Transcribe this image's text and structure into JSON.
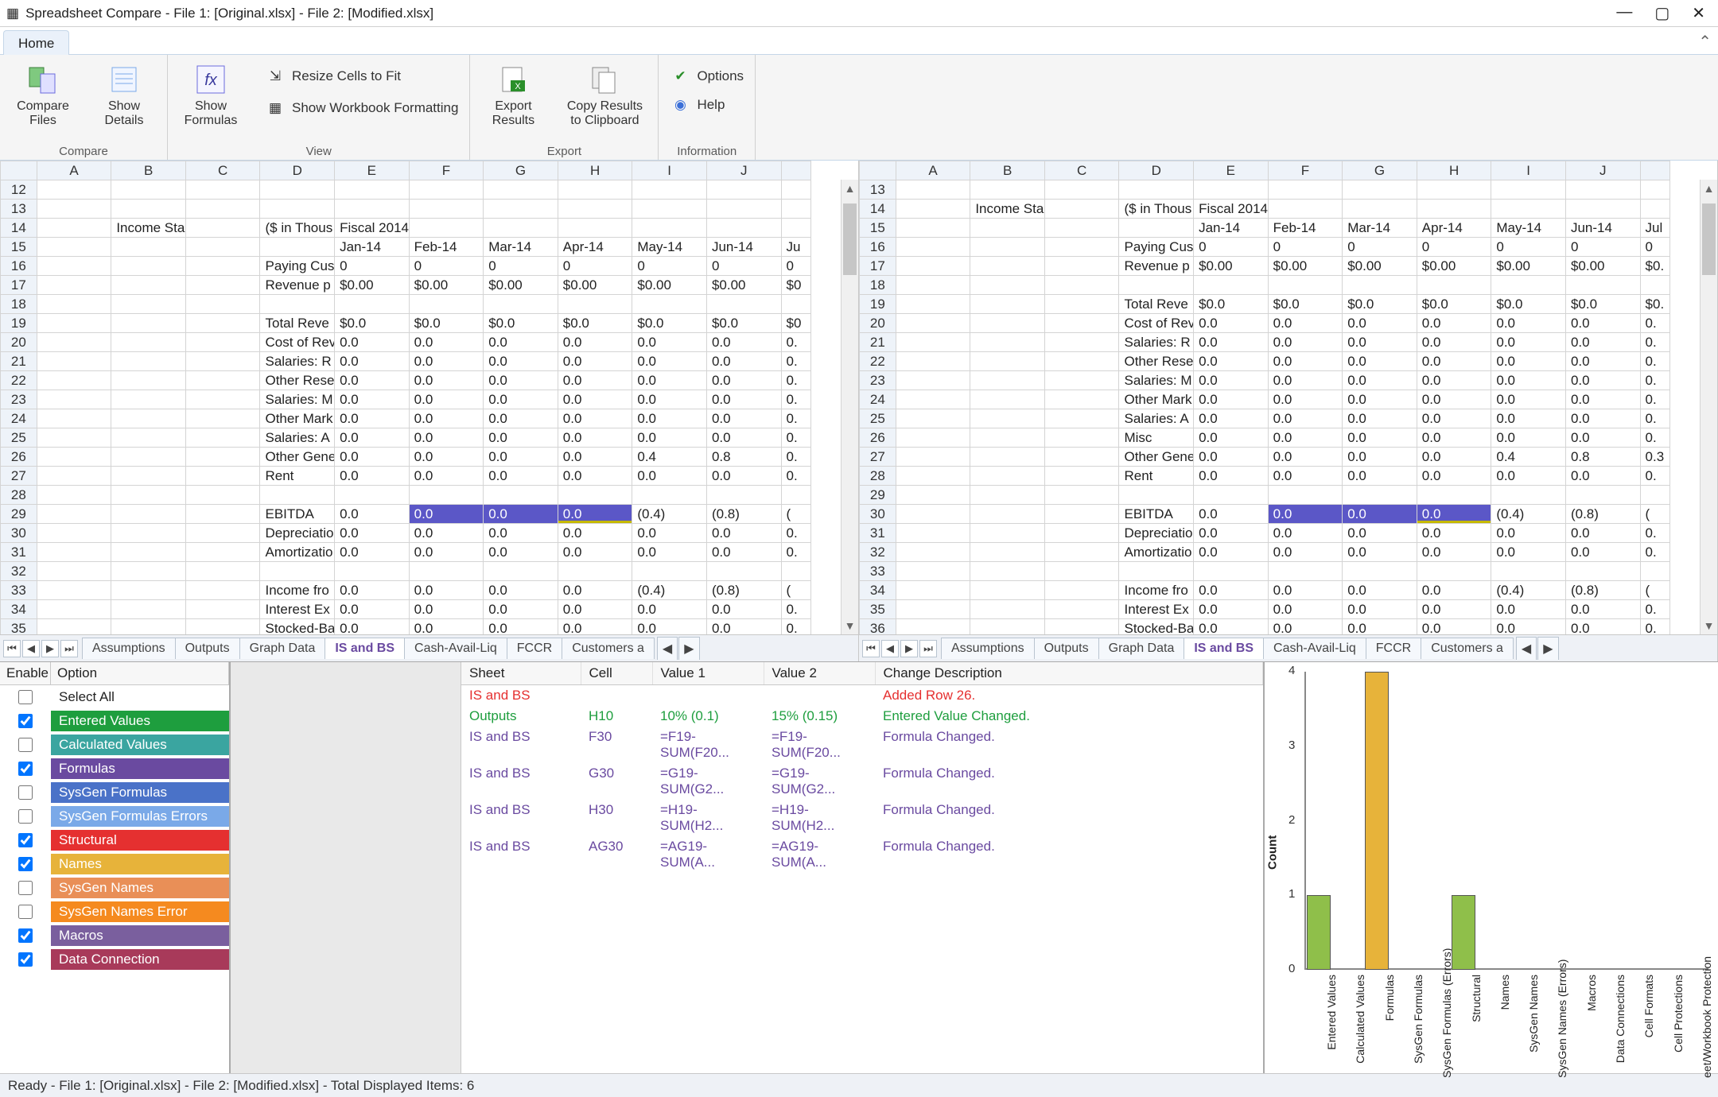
{
  "window": {
    "title": "Spreadsheet Compare - File 1: [Original.xlsx] - File 2: [Modified.xlsx]"
  },
  "ribbon": {
    "tab": "Home",
    "groups": {
      "compare": "Compare",
      "view": "View",
      "export": "Export",
      "information": "Information"
    },
    "buttons": {
      "compare_files": "Compare Files",
      "show_details": "Show Details",
      "show_formulas": "Show Formulas",
      "resize_cells": "Resize Cells to Fit",
      "show_wb_fmt": "Show Workbook Formatting",
      "export_results": "Export Results",
      "copy_clipboard": "Copy Results to Clipboard",
      "options": "Options",
      "help": "Help"
    }
  },
  "sheet_tabs": [
    "Assumptions",
    "Outputs",
    "Graph Data",
    "IS and BS",
    "Cash-Avail-Liq",
    "FCCR",
    "Customers a"
  ],
  "sheet_selected": "IS and BS",
  "columns": [
    "A",
    "B",
    "C",
    "D",
    "E",
    "F",
    "G",
    "H",
    "I",
    "J"
  ],
  "grid_left": {
    "start_row": 12,
    "rows": [
      {
        "r": 12
      },
      {
        "r": 13
      },
      {
        "r": 14,
        "B": "Income Sta",
        "D": "($ in Thous",
        "E": "Fiscal 2014"
      },
      {
        "r": 15,
        "E": "Jan-14",
        "F": "Feb-14",
        "G": "Mar-14",
        "H": "Apr-14",
        "I": "May-14",
        "J": "Jun-14",
        "K": "Ju"
      },
      {
        "r": 16,
        "D": "Paying Cus",
        "E": "0",
        "F": "0",
        "G": "0",
        "H": "0",
        "I": "0",
        "J": "0",
        "K": "0"
      },
      {
        "r": 17,
        "D": "Revenue p",
        "E": "$0.00",
        "F": "$0.00",
        "G": "$0.00",
        "H": "$0.00",
        "I": "$0.00",
        "J": "$0.00",
        "K": "$0"
      },
      {
        "r": 18
      },
      {
        "r": 19,
        "D": "Total Reve",
        "E": "$0.0",
        "F": "$0.0",
        "G": "$0.0",
        "H": "$0.0",
        "I": "$0.0",
        "J": "$0.0",
        "K": "$0"
      },
      {
        "r": 20,
        "D": "Cost of Rev",
        "E": "0.0",
        "F": "0.0",
        "G": "0.0",
        "H": "0.0",
        "I": "0.0",
        "J": "0.0",
        "K": "0."
      },
      {
        "r": 21,
        "D": "Salaries: R",
        "E": "0.0",
        "F": "0.0",
        "G": "0.0",
        "H": "0.0",
        "I": "0.0",
        "J": "0.0",
        "K": "0."
      },
      {
        "r": 22,
        "D": "Other Rese",
        "E": "0.0",
        "F": "0.0",
        "G": "0.0",
        "H": "0.0",
        "I": "0.0",
        "J": "0.0",
        "K": "0."
      },
      {
        "r": 23,
        "D": "Salaries: M",
        "E": "0.0",
        "F": "0.0",
        "G": "0.0",
        "H": "0.0",
        "I": "0.0",
        "J": "0.0",
        "K": "0."
      },
      {
        "r": 24,
        "D": "Other Mark",
        "E": "0.0",
        "F": "0.0",
        "G": "0.0",
        "H": "0.0",
        "I": "0.0",
        "J": "0.0",
        "K": "0."
      },
      {
        "r": 25,
        "D": "Salaries: A",
        "E": "0.0",
        "F": "0.0",
        "G": "0.0",
        "H": "0.0",
        "I": "0.0",
        "J": "0.0",
        "K": "0."
      },
      {
        "r": 26,
        "D": "Other Gene",
        "E": "0.0",
        "F": "0.0",
        "G": "0.0",
        "H": "0.0",
        "I": "0.4",
        "J": "0.8",
        "K": "0."
      },
      {
        "r": 27,
        "D": "Rent",
        "E": "0.0",
        "F": "0.0",
        "G": "0.0",
        "H": "0.0",
        "I": "0.0",
        "J": "0.0",
        "K": "0."
      },
      {
        "r": 28
      },
      {
        "r": 29,
        "D": "EBITDA",
        "E": "0.0",
        "F": "0.0",
        "G": "0.0",
        "H": "0.0",
        "I": "(0.4)",
        "J": "(0.8)",
        "K": "(",
        "hl": [
          "F",
          "G",
          "H"
        ]
      },
      {
        "r": 30,
        "D": "Depreciatio",
        "E": "0.0",
        "F": "0.0",
        "G": "0.0",
        "H": "0.0",
        "I": "0.0",
        "J": "0.0",
        "K": "0."
      },
      {
        "r": 31,
        "D": "Amortizatio",
        "E": "0.0",
        "F": "0.0",
        "G": "0.0",
        "H": "0.0",
        "I": "0.0",
        "J": "0.0",
        "K": "0."
      },
      {
        "r": 32
      },
      {
        "r": 33,
        "D": "Income fro",
        "E": "0.0",
        "F": "0.0",
        "G": "0.0",
        "H": "0.0",
        "I": "(0.4)",
        "J": "(0.8)",
        "K": "("
      },
      {
        "r": 34,
        "D": "Interest Ex",
        "E": "0.0",
        "F": "0.0",
        "G": "0.0",
        "H": "0.0",
        "I": "0.0",
        "J": "0.0",
        "K": "0."
      },
      {
        "r": 35,
        "D": "Stocked-Ba",
        "E": "0.0",
        "F": "0.0",
        "G": "0.0",
        "H": "0.0",
        "I": "0.0",
        "J": "0.0",
        "K": "0."
      }
    ]
  },
  "grid_right": {
    "start_row": 13,
    "rows": [
      {
        "r": 13
      },
      {
        "r": 14,
        "B": "Income Sta",
        "D": "($ in Thous",
        "E": "Fiscal 2014"
      },
      {
        "r": 15,
        "E": "Jan-14",
        "F": "Feb-14",
        "G": "Mar-14",
        "H": "Apr-14",
        "I": "May-14",
        "J": "Jun-14",
        "K": "Jul"
      },
      {
        "r": 16,
        "D": "Paying Cus",
        "E": "0",
        "F": "0",
        "G": "0",
        "H": "0",
        "I": "0",
        "J": "0",
        "K": "0"
      },
      {
        "r": 17,
        "D": "Revenue p",
        "E": "$0.00",
        "F": "$0.00",
        "G": "$0.00",
        "H": "$0.00",
        "I": "$0.00",
        "J": "$0.00",
        "K": "$0."
      },
      {
        "r": 18
      },
      {
        "r": 19,
        "D": "Total Reve",
        "E": "$0.0",
        "F": "$0.0",
        "G": "$0.0",
        "H": "$0.0",
        "I": "$0.0",
        "J": "$0.0",
        "K": "$0."
      },
      {
        "r": 20,
        "D": "Cost of Rev",
        "E": "0.0",
        "F": "0.0",
        "G": "0.0",
        "H": "0.0",
        "I": "0.0",
        "J": "0.0",
        "K": "0."
      },
      {
        "r": 21,
        "D": "Salaries: R",
        "E": "0.0",
        "F": "0.0",
        "G": "0.0",
        "H": "0.0",
        "I": "0.0",
        "J": "0.0",
        "K": "0."
      },
      {
        "r": 22,
        "D": "Other Rese",
        "E": "0.0",
        "F": "0.0",
        "G": "0.0",
        "H": "0.0",
        "I": "0.0",
        "J": "0.0",
        "K": "0."
      },
      {
        "r": 23,
        "D": "Salaries: M",
        "E": "0.0",
        "F": "0.0",
        "G": "0.0",
        "H": "0.0",
        "I": "0.0",
        "J": "0.0",
        "K": "0."
      },
      {
        "r": 24,
        "D": "Other Mark",
        "E": "0.0",
        "F": "0.0",
        "G": "0.0",
        "H": "0.0",
        "I": "0.0",
        "J": "0.0",
        "K": "0."
      },
      {
        "r": 25,
        "D": "Salaries: A",
        "E": "0.0",
        "F": "0.0",
        "G": "0.0",
        "H": "0.0",
        "I": "0.0",
        "J": "0.0",
        "K": "0."
      },
      {
        "r": 26,
        "D": "Misc",
        "E": "0.0",
        "F": "0.0",
        "G": "0.0",
        "H": "0.0",
        "I": "0.0",
        "J": "0.0",
        "K": "0."
      },
      {
        "r": 27,
        "D": "Other Gene",
        "E": "0.0",
        "F": "0.0",
        "G": "0.0",
        "H": "0.0",
        "I": "0.4",
        "J": "0.8",
        "K": "0.3"
      },
      {
        "r": 28,
        "D": "Rent",
        "E": "0.0",
        "F": "0.0",
        "G": "0.0",
        "H": "0.0",
        "I": "0.0",
        "J": "0.0",
        "K": "0."
      },
      {
        "r": 29
      },
      {
        "r": 30,
        "D": "EBITDA",
        "E": "0.0",
        "F": "0.0",
        "G": "0.0",
        "H": "0.0",
        "I": "(0.4)",
        "J": "(0.8)",
        "K": "(",
        "hl": [
          "F",
          "G",
          "H"
        ]
      },
      {
        "r": 31,
        "D": "Depreciatio",
        "E": "0.0",
        "F": "0.0",
        "G": "0.0",
        "H": "0.0",
        "I": "0.0",
        "J": "0.0",
        "K": "0."
      },
      {
        "r": 32,
        "D": "Amortizatio",
        "E": "0.0",
        "F": "0.0",
        "G": "0.0",
        "H": "0.0",
        "I": "0.0",
        "J": "0.0",
        "K": "0."
      },
      {
        "r": 33
      },
      {
        "r": 34,
        "D": "Income fro",
        "E": "0.0",
        "F": "0.0",
        "G": "0.0",
        "H": "0.0",
        "I": "(0.4)",
        "J": "(0.8)",
        "K": "("
      },
      {
        "r": 35,
        "D": "Interest Ex",
        "E": "0.0",
        "F": "0.0",
        "G": "0.0",
        "H": "0.0",
        "I": "0.0",
        "J": "0.0",
        "K": "0."
      },
      {
        "r": 36,
        "D": "Stocked-Ba",
        "E": "0.0",
        "F": "0.0",
        "G": "0.0",
        "H": "0.0",
        "I": "0.0",
        "J": "0.0",
        "K": "0."
      }
    ]
  },
  "options_panel": {
    "headers": {
      "enable": "Enable",
      "option": "Option"
    },
    "rows": [
      {
        "label": "Select All",
        "checked": false,
        "color": "#ffffff",
        "plain": true
      },
      {
        "label": "Entered Values",
        "checked": true,
        "color": "#1e9e3e"
      },
      {
        "label": "Calculated Values",
        "checked": false,
        "color": "#3aa5a0"
      },
      {
        "label": "Formulas",
        "checked": true,
        "color": "#6a4aa0"
      },
      {
        "label": "SysGen Formulas",
        "checked": false,
        "color": "#4a72c8"
      },
      {
        "label": "SysGen Formulas Errors",
        "checked": false,
        "color": "#7aa9e8"
      },
      {
        "label": "Structural",
        "checked": true,
        "color": "#e53030"
      },
      {
        "label": "Names",
        "checked": true,
        "color": "#e7b33a"
      },
      {
        "label": "SysGen Names",
        "checked": false,
        "color": "#e98f57"
      },
      {
        "label": "SysGen Names Error",
        "checked": false,
        "color": "#f58a1f"
      },
      {
        "label": "Macros",
        "checked": true,
        "color": "#7a5f9e"
      },
      {
        "label": "Data Connection",
        "checked": true,
        "color": "#a83a5a"
      }
    ]
  },
  "results": {
    "headers": [
      "Sheet",
      "Cell",
      "Value 1",
      "Value 2",
      "Change Description"
    ],
    "rows": [
      {
        "c": [
          "IS and BS",
          "",
          "",
          "",
          "Added Row 26."
        ],
        "color": "#e53030"
      },
      {
        "c": [
          "Outputs",
          "H10",
          "10% (0.1)",
          "15% (0.15)",
          "Entered Value Changed."
        ],
        "color": "#1e9e3e"
      },
      {
        "c": [
          "IS and BS",
          "F30",
          "=F19-SUM(F20...",
          "=F19-SUM(F20...",
          "Formula Changed."
        ],
        "color": "#6a4aa0"
      },
      {
        "c": [
          "IS and BS",
          "G30",
          "=G19-SUM(G2...",
          "=G19-SUM(G2...",
          "Formula Changed."
        ],
        "color": "#6a4aa0"
      },
      {
        "c": [
          "IS and BS",
          "H30",
          "=H19-SUM(H2...",
          "=H19-SUM(H2...",
          "Formula Changed."
        ],
        "color": "#6a4aa0"
      },
      {
        "c": [
          "IS and BS",
          "AG30",
          "=AG19-SUM(A...",
          "=AG19-SUM(A...",
          "Formula Changed."
        ],
        "color": "#6a4aa0"
      }
    ]
  },
  "chart_data": {
    "type": "bar",
    "ylabel": "Count",
    "ylim": [
      0,
      4
    ],
    "categories": [
      "Entered Values",
      "Calculated Values",
      "Formulas",
      "SysGen Formulas",
      "SysGen Formulas (Errors)",
      "Structural",
      "Names",
      "SysGen Names",
      "SysGen Names (Errors)",
      "Macros",
      "Data Connections",
      "Cell Formats",
      "Cell Protections",
      "eet/Workbook Protection"
    ],
    "values": [
      1,
      0,
      4,
      0,
      0,
      1,
      0,
      0,
      0,
      0,
      0,
      0,
      0,
      0
    ],
    "colors": [
      "#8fbf4a",
      "#3aa5a0",
      "#e7b33a",
      "#4a72c8",
      "#7aa9e8",
      "#8fbf4a",
      "#e7b33a",
      "#e98f57",
      "#f58a1f",
      "#7a5f9e",
      "#a83a5a",
      "#888",
      "#888",
      "#888"
    ]
  },
  "statusbar": "Ready - File 1: [Original.xlsx] - File 2: [Modified.xlsx] - Total Displayed Items: 6"
}
